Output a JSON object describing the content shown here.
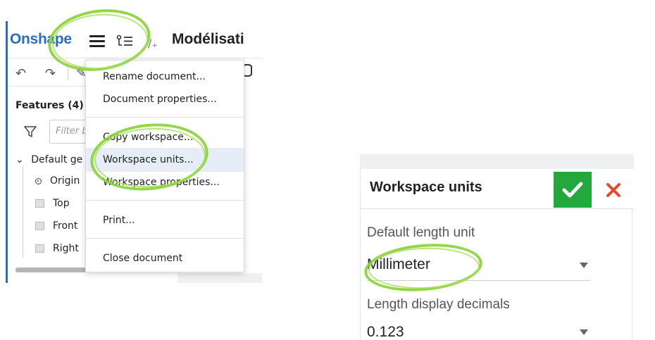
{
  "app": {
    "logo_text": "Onshape",
    "document_title": "Modélisati",
    "brand_color": "#2a6cc2"
  },
  "toolbar": {
    "undo_icon": "undo-icon",
    "redo_icon": "redo-icon",
    "sketch_icon": "sketch-pencil-icon",
    "extrude_icon": "cylinder-icon"
  },
  "feature_panel": {
    "title": "Features (4)",
    "filter_placeholder": "Filter b",
    "group_label": "Default ge",
    "items": [
      {
        "label": "Origin",
        "icon": "origin-icon"
      },
      {
        "label": "Top",
        "icon": "plane-icon"
      },
      {
        "label": "Front",
        "icon": "plane-icon"
      },
      {
        "label": "Right",
        "icon": "plane-icon"
      }
    ]
  },
  "document_menu": {
    "items": [
      {
        "label": "Rename document..."
      },
      {
        "label": "Document properties..."
      },
      {
        "label": "Copy workspace..."
      },
      {
        "label": "Workspace units..."
      },
      {
        "label": "Workspace properties..."
      },
      {
        "label": "Print..."
      },
      {
        "label": "Close document"
      }
    ],
    "highlighted_item": "Workspace units...",
    "highlight_color": "#e6edf6"
  },
  "units_dialog": {
    "title": "Workspace units",
    "ok_color": "#22a83c",
    "cancel_color": "#e8482c",
    "length_unit_label": "Default length unit",
    "length_unit_value": "Millimeter",
    "decimals_label": "Length display decimals",
    "decimals_value": "0.123"
  },
  "annotation_color": "#8bd23a"
}
